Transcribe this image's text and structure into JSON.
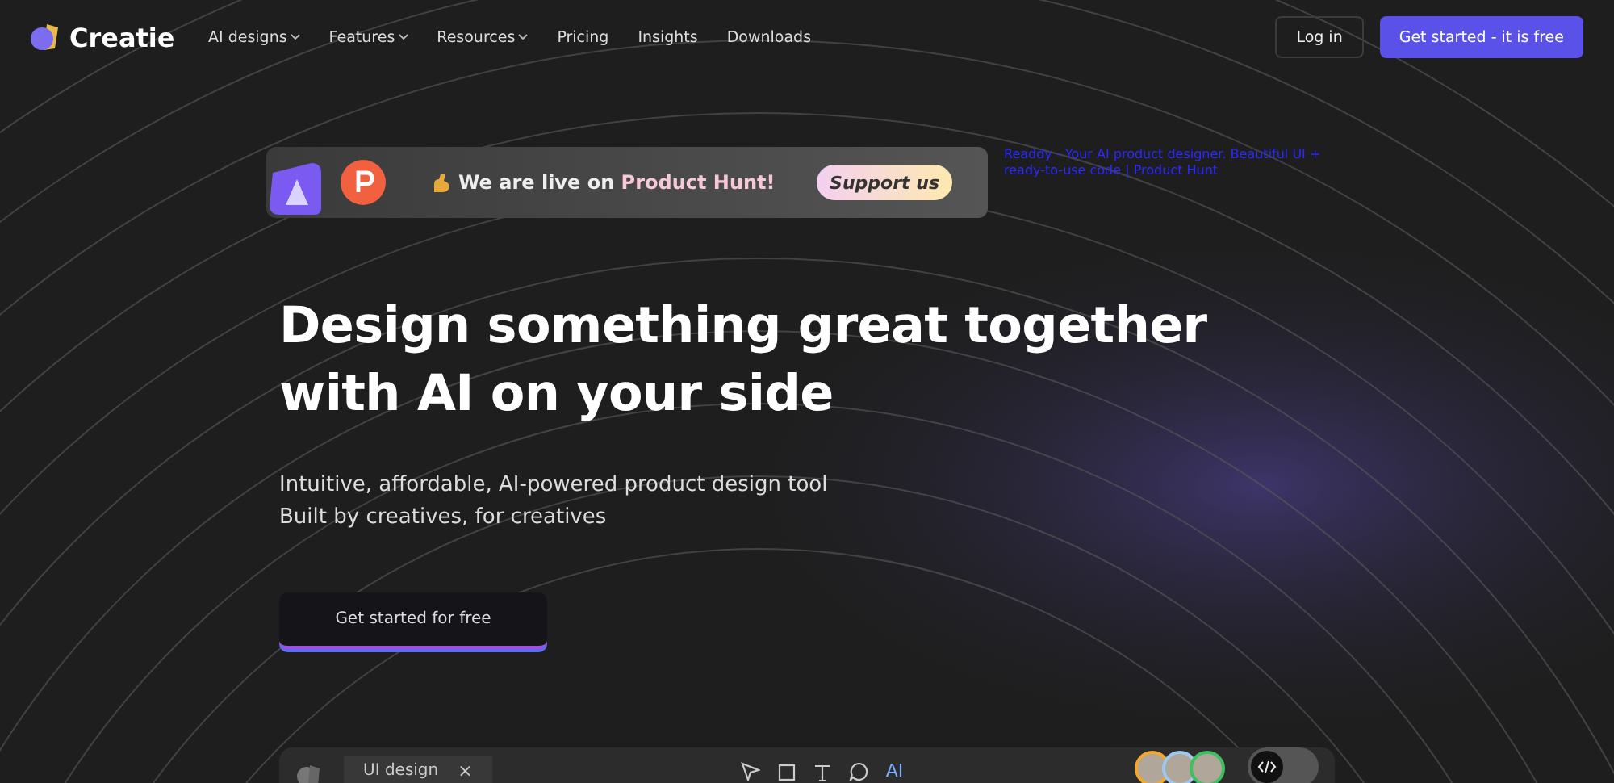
{
  "header": {
    "brand": "Creatie",
    "nav": [
      {
        "label": "AI designs",
        "dropdown": true
      },
      {
        "label": "Features",
        "dropdown": true
      },
      {
        "label": "Resources",
        "dropdown": true
      },
      {
        "label": "Pricing",
        "dropdown": false
      },
      {
        "label": "Insights",
        "dropdown": false
      },
      {
        "label": "Downloads",
        "dropdown": false
      }
    ],
    "login": "Log in",
    "cta": "Get started - it is free"
  },
  "banner": {
    "headline": "We are live on",
    "highlight": "Product Hunt!",
    "button": "Support us"
  },
  "badge_alt": "Readdy - Your AI product designer. Beautiful UI + ready-to-use code | Product Hunt",
  "hero": {
    "title_lines": [
      "Design something great together",
      "with AI on your side"
    ],
    "subtitle_lines": [
      "Intuitive, affordable, AI-powered product design tool",
      "Built by creatives, for creatives"
    ],
    "button": "Get started for free"
  },
  "editor_toolbar": {
    "tab": "UI design",
    "close": "×",
    "ai": "AI",
    "avatars": [
      {
        "color": "#f0a830"
      },
      {
        "color": "#9ec8f0"
      },
      {
        "color": "#3fc060"
      }
    ],
    "code_toggle": {
      "on": false
    }
  }
}
